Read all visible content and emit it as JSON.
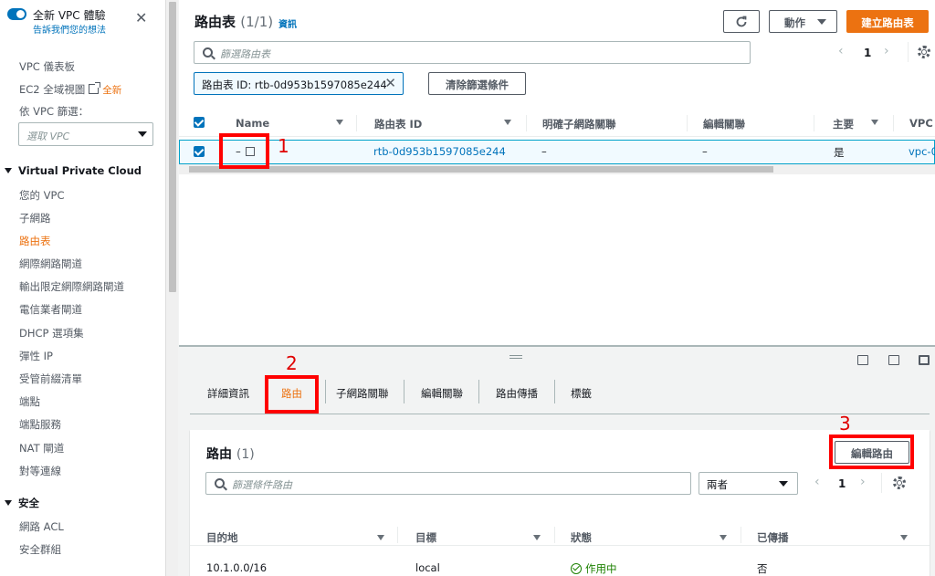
{
  "sidebar": {
    "new_experience_title": "全新 VPC 體驗",
    "new_experience_sub": "告訴我們您的想法",
    "close": "✕",
    "vpc_dashboard": "VPC 儀表板",
    "ec2_global_view": "EC2 全域視圖",
    "new_badge": "全新",
    "filter_by_vpc": "依 VPC 篩選：",
    "select_vpc_placeholder": "選取 VPC",
    "section_vpc": "Virtual Private Cloud",
    "vpc_items": [
      "您的 VPC",
      "子網路",
      "路由表",
      "網際網路閘道",
      "輸出限定網際網路閘道",
      "電信業者閘道",
      "DHCP 選項集",
      "彈性 IP",
      "受管前綴清單",
      "端點",
      "端點服務",
      "NAT 閘道",
      "對等連線"
    ],
    "section_security": "安全",
    "security_items": [
      "網路 ACL",
      "安全群組"
    ]
  },
  "header": {
    "title": "路由表",
    "count": "(1/1)",
    "info": "資訊",
    "actions": "動作",
    "create": "建立路由表",
    "search_placeholder": "篩選路由表",
    "page": "1",
    "filter_token": "路由表 ID: rtb-0d953b1597085e244",
    "clear_filters": "清除篩選條件"
  },
  "table": {
    "columns": [
      "Name",
      "路由表 ID",
      "明確子網路關聯",
      "編輯關聯",
      "主要",
      "VPC"
    ],
    "row": {
      "name": "–",
      "route_table_id": "rtb-0d953b1597085e244",
      "explicit_assoc": "–",
      "edge_assoc": "–",
      "main": "是",
      "vpc": "vpc-0"
    }
  },
  "tabs": [
    "詳細資訊",
    "路由",
    "子網路關聯",
    "編輯關聯",
    "路由傳播",
    "標籤"
  ],
  "routes": {
    "title": "路由",
    "count": "(1)",
    "edit_button": "編輯路由",
    "search_placeholder": "篩選條件路由",
    "select_value": "兩者",
    "page": "1",
    "columns": [
      "目的地",
      "目標",
      "狀態",
      "已傳播"
    ],
    "row": {
      "destination": "10.1.0.0/16",
      "target": "local",
      "status": "作用中",
      "propagated": "否"
    }
  },
  "annotations": [
    "1",
    "2",
    "3"
  ],
  "colors": {
    "accent": "#ec7211",
    "link": "#0073bb",
    "annotation": "#ff0000",
    "success": "#1d8102"
  }
}
